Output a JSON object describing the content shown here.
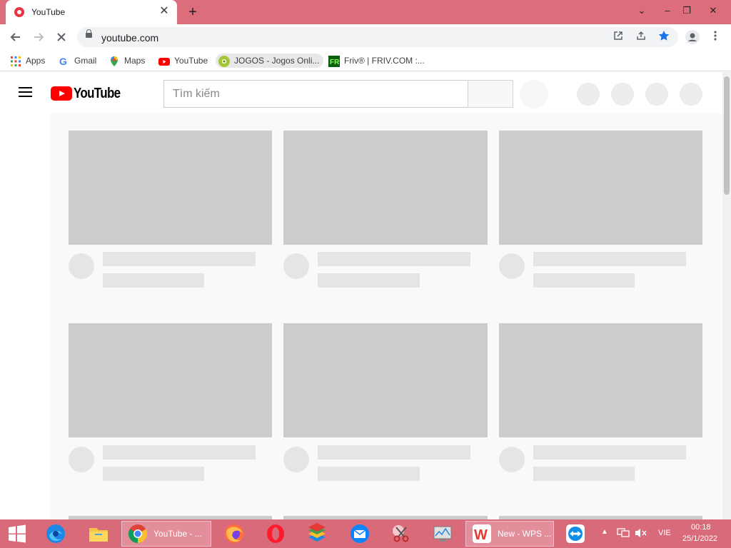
{
  "browser": {
    "tab_title": "YouTube",
    "tab_close": "✕",
    "new_tab": "+",
    "window_controls": {
      "tab_search": "⌄",
      "minimize": "–",
      "restore": "❐",
      "close": "✕"
    },
    "url": "youtube.com"
  },
  "bookmarks": [
    {
      "label": "Apps"
    },
    {
      "label": "Gmail"
    },
    {
      "label": "Maps"
    },
    {
      "label": "YouTube"
    },
    {
      "label": "JOGOS - Jogos Onli..."
    },
    {
      "label": "Friv® | FRIV.COM :..."
    }
  ],
  "youtube": {
    "logo_text": "YouTube",
    "search_placeholder": "Tìm kiếm"
  },
  "taskbar": {
    "chrome_window": "YouTube - ...",
    "wps_window": "New - WPS ...",
    "language": "VIE",
    "time": "00:18",
    "date": "25/1/2022"
  },
  "colors": {
    "titlebar": "#dc6e7b",
    "taskbar": "#d86a7a",
    "youtube_red": "#ff0000",
    "placeholder_dark": "#cccccc",
    "placeholder_light": "#e5e5e5"
  }
}
